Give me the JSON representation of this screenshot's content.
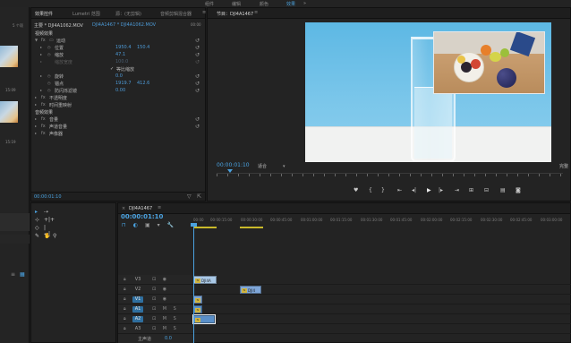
{
  "menu": {
    "items": [
      {
        "label": "组件",
        "active": false
      },
      {
        "label": "编辑",
        "active": false
      },
      {
        "label": "颜色",
        "active": false
      },
      {
        "label": "效果",
        "active": true
      }
    ],
    "more": "»"
  },
  "left_panel": {
    "overflow": "5 个项",
    "thumbs": [
      {
        "time": "15:09"
      },
      {
        "time": "15:19"
      }
    ]
  },
  "effect_controls": {
    "tabs": [
      {
        "label": "效果控件",
        "active": true
      },
      {
        "label": "Lumetri 范围",
        "active": false
      },
      {
        "label": "源：(无剪辑)",
        "active": false
      },
      {
        "label": "音频剪辑混合器",
        "active": false
      }
    ],
    "menu_icon": "≡",
    "source": "主要 * DJI4A1062.MOV",
    "sequence": "DJI4A1467 * DJI4A1062.MOV",
    "clip_time": "00:00",
    "sections": {
      "video": "视频效果",
      "motion": "运动",
      "position": "位置",
      "position_x": "1950.4",
      "position_y": "150.4",
      "scale": "缩放",
      "scale_val": "47.1",
      "scale_width": "缩放宽度",
      "scale_width_val": "100.0",
      "uniform": "等比缩放",
      "rotation": "旋转",
      "rotation_val": "0.0",
      "anchor": "锚点",
      "anchor_x": "1919.7",
      "anchor_y": "412.6",
      "flicker": "防闪烁滤镜",
      "flicker_val": "0.00",
      "opacity": "不透明度",
      "remap": "时间重映射",
      "audio": "音频效果",
      "volume": "音量",
      "channel": "声道音量",
      "panner": "声像器"
    },
    "time": "00:00:01:10"
  },
  "program": {
    "tab": "节目：DJI4A1467",
    "menu_icon": "≡",
    "timecode": "00:00:01:10",
    "fit": "适合",
    "full": "完整",
    "controls": [
      "♥",
      "{",
      "}",
      "⇤",
      "◂|",
      "▶",
      "|▸",
      "⇥",
      "⊞",
      "⊟",
      "▤",
      "◙"
    ]
  },
  "tools": [
    "▸",
    "⇢",
    "⊹",
    "+|+",
    "◇",
    "|↔|",
    "✎",
    "✋",
    "⚲"
  ],
  "project": {
    "list_icon": "≡",
    "grid_icon": "▦"
  },
  "timeline": {
    "tab": "DJI4A1467",
    "close_icon": "×",
    "menu_icon": "≡",
    "timecode": "00:00:01:10",
    "ruler": [
      "00:00",
      "00:00:15:00",
      "00:00:30:00",
      "00:00:45:00",
      "00:01:00:00",
      "00:01:15:00",
      "00:01:30:00",
      "00:01:45:00",
      "00:02:00:00",
      "00:02:15:00",
      "00:02:30:00",
      "00:02:45:00",
      "00:03:00:00"
    ],
    "tracks": [
      {
        "name": "V3",
        "icons": "⊡ ◉",
        "on": false
      },
      {
        "name": "V2",
        "icons": "⊡ ◉",
        "on": false
      },
      {
        "name": "V1",
        "icons": "⊡ ◉",
        "on": true
      },
      {
        "name": "A1",
        "icons": "⊡ M S",
        "on": true
      },
      {
        "name": "A2",
        "icons": "⊡ M S",
        "on": true
      },
      {
        "name": "A3",
        "icons": "⊡ M S",
        "on": false
      }
    ],
    "master_label": "主声道",
    "master_value": "0.0",
    "clips": {
      "v3": "DJI4A",
      "v2": "DJI4",
      "fx": "fx"
    }
  }
}
